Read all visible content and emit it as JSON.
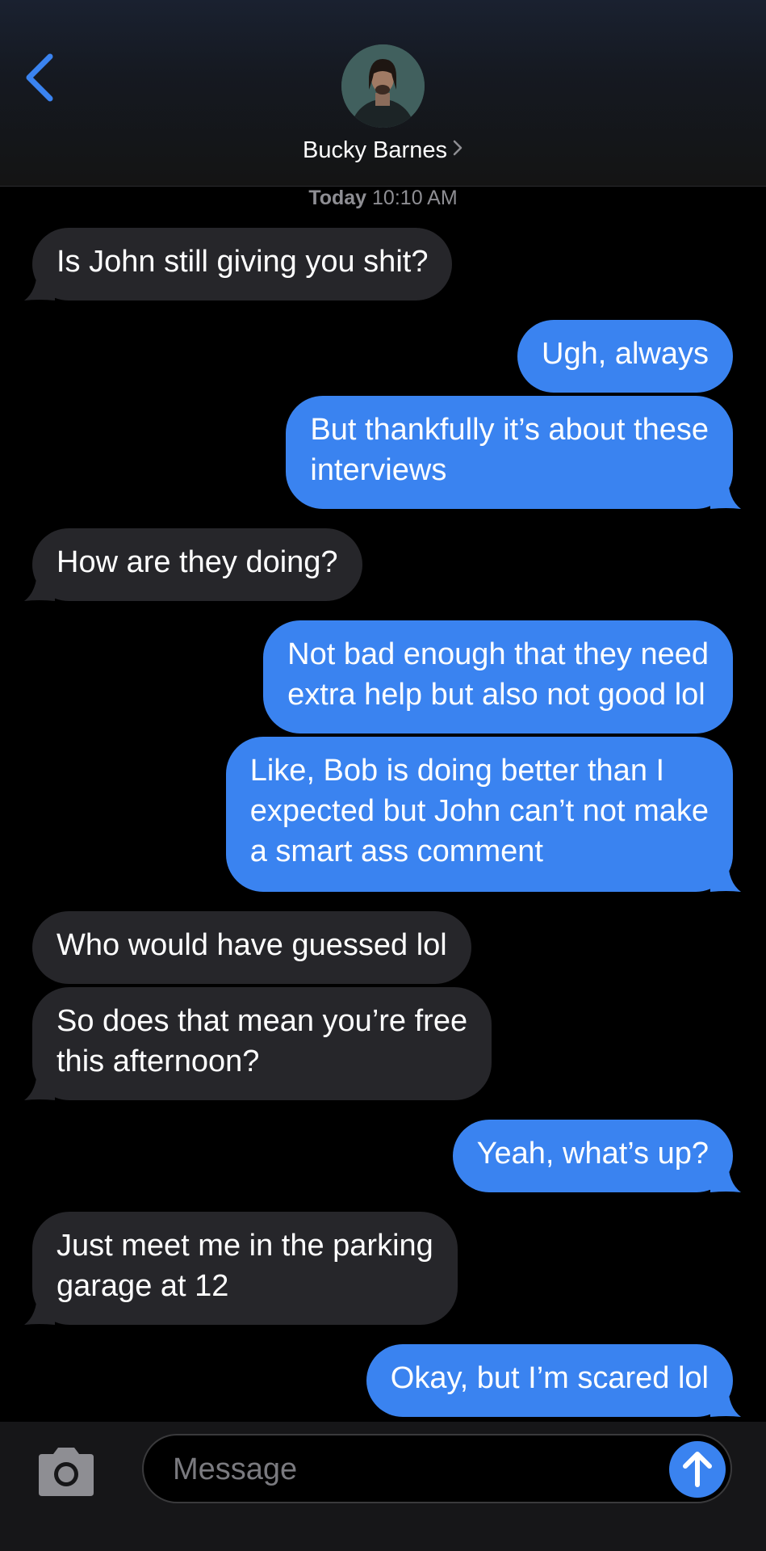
{
  "header": {
    "contact_name": "Bucky Barnes",
    "accent_color": "#3a83f0"
  },
  "timestamp": {
    "day": "Today",
    "time": "10:10 AM"
  },
  "messages": [
    {
      "direction": "incoming",
      "text": "Is John still giving you shit?"
    },
    {
      "direction": "outgoing",
      "text": "Ugh, always"
    },
    {
      "direction": "outgoing",
      "text": "But thankfully it’s about these\ninterviews"
    },
    {
      "direction": "incoming",
      "text": "How are they doing?"
    },
    {
      "direction": "outgoing",
      "text": "Not bad enough that they need\nextra help but also not good lol"
    },
    {
      "direction": "outgoing",
      "text": "Like, Bob is doing better than I\nexpected but John can’t not make\na smart ass comment"
    },
    {
      "direction": "incoming",
      "text": "Who would have guessed lol"
    },
    {
      "direction": "incoming",
      "text": "So does that mean you’re free\nthis afternoon?"
    },
    {
      "direction": "outgoing",
      "text": "Yeah, what’s up?"
    },
    {
      "direction": "incoming",
      "text": "Just meet me in the parking\ngarage at 12"
    },
    {
      "direction": "outgoing",
      "text": "Okay, but I’m scared lol"
    }
  ],
  "composer": {
    "placeholder": "Message",
    "value": ""
  },
  "icons": {
    "back": "chevron-left-icon",
    "contact_details": "chevron-right-icon",
    "camera": "camera-icon",
    "send": "arrow-up-icon"
  },
  "colors": {
    "incoming_bubble": "#26262a",
    "outgoing_bubble": "#3a83f0",
    "background": "#000000"
  }
}
